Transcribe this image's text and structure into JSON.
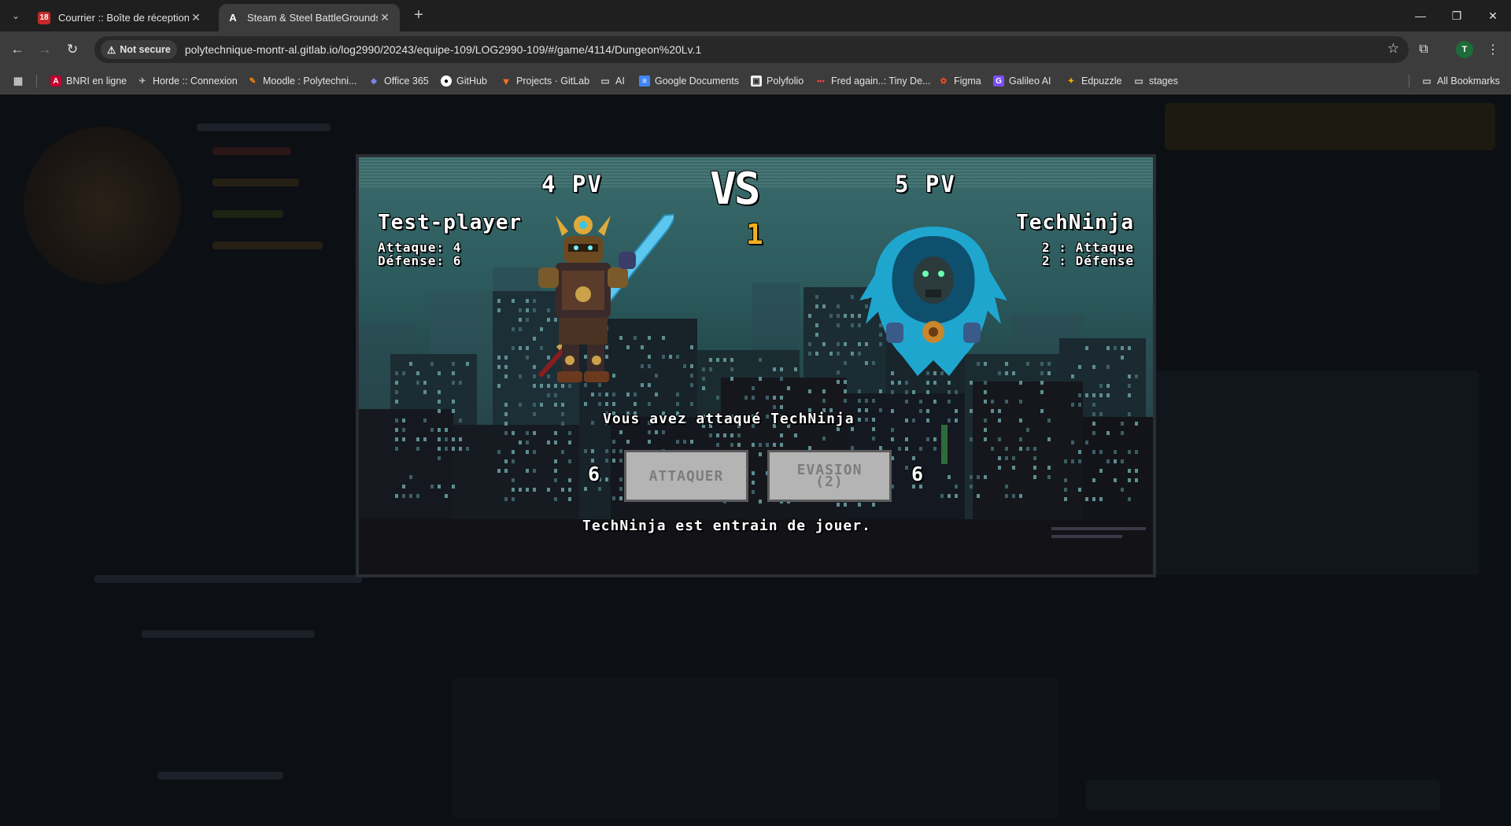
{
  "browser": {
    "tabs": [
      {
        "title": "Courrier :: Boîte de réception",
        "badge": "18",
        "active": false
      },
      {
        "title": "Steam & Steel BattleGrounds",
        "active": true
      }
    ],
    "security_label": "Not secure",
    "url": "polytechnique-montr-al.gitlab.io/log2990/20243/equipe-109/LOG2990-109/#/game/4114/Dungeon%20Lv.1",
    "profile_initial": "T",
    "bookmarks": [
      {
        "label": "BNRI en ligne",
        "icon": "angular-icon"
      },
      {
        "label": "Horde :: Connexion",
        "icon": "horde-icon"
      },
      {
        "label": "Moodle : Polytechni...",
        "icon": "moodle-icon"
      },
      {
        "label": "Office 365",
        "icon": "office-icon"
      },
      {
        "label": "GitHub",
        "icon": "github-icon"
      },
      {
        "label": "Projects · GitLab",
        "icon": "gitlab-icon"
      },
      {
        "label": "AI",
        "icon": "folder-icon"
      },
      {
        "label": "Google Documents",
        "icon": "docs-icon"
      },
      {
        "label": "Polyfolio",
        "icon": "polyfolio-icon"
      },
      {
        "label": "Fred again..: Tiny De...",
        "icon": "music-icon"
      },
      {
        "label": "Figma",
        "icon": "figma-icon"
      },
      {
        "label": "Galileo AI",
        "icon": "galileo-icon"
      },
      {
        "label": "Edpuzzle",
        "icon": "edpuzzle-icon"
      },
      {
        "label": "stages",
        "icon": "folder-icon"
      }
    ],
    "all_bookmarks_label": "All Bookmarks"
  },
  "combat": {
    "player": {
      "name": "Test-player",
      "hp_label": "4 PV",
      "attack_line": "Attaque: 4",
      "defense_line": "Défense: 6",
      "dice_value": "6"
    },
    "opponent": {
      "name": "TechNinja",
      "hp_label": "5 PV",
      "attack_line": "2 : Attaque",
      "defense_line": "2 : Défense",
      "dice_value": "6"
    },
    "vs_label": "VS",
    "round_number": "1",
    "action_message": "Vous avez attaqué TechNinja",
    "attack_button": "ATTAQUER",
    "evasion_button_line1": "EVASION",
    "evasion_button_line2": "(2)",
    "turn_message": "TechNinja est entrain de jouer.",
    "colors": {
      "round": "#f2b01e",
      "text": "#ffffff",
      "button_disabled": "#b4b4b4"
    }
  }
}
